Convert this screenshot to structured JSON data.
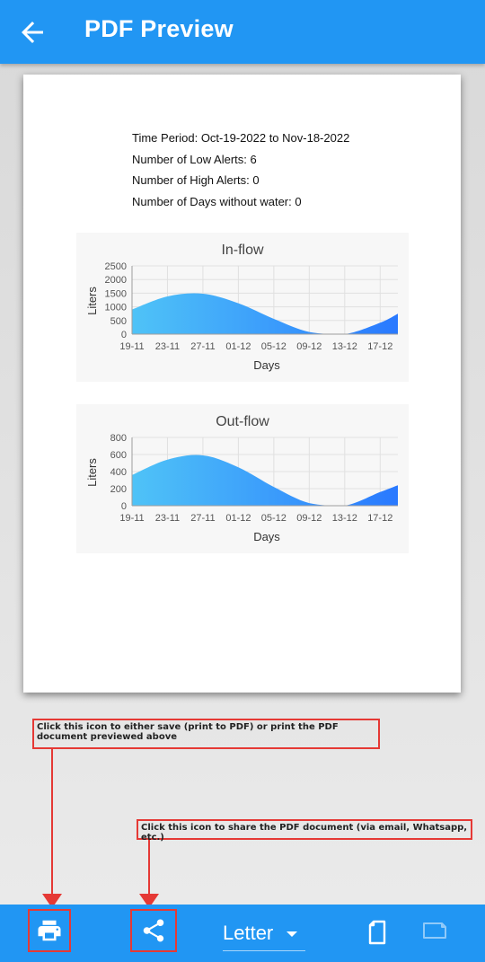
{
  "app_bar": {
    "title": "PDF Preview"
  },
  "icons": {
    "back": "arrow-back-icon",
    "print": "printer-icon",
    "share": "share-icon",
    "portrait": "portrait-page-icon",
    "landscape": "landscape-page-icon",
    "dropdown": "caret-down-icon"
  },
  "colors": {
    "accent": "#2196f3",
    "gradient_start": "#4fc3f7",
    "gradient_end": "#2979ff",
    "annotation": "#e53935"
  },
  "summary": {
    "time_period": "Time Period: Oct-19-2022 to Nov-18-2022",
    "low_alerts": "Number of Low Alerts: 6",
    "high_alerts": "Number of High Alerts: 0",
    "days_without_water": "Number of Days without water: 0"
  },
  "chart_data": [
    {
      "type": "area",
      "title": "In-flow",
      "xlabel": "Days",
      "ylabel": "Liters",
      "x_tick_labels": [
        "19-11",
        "23-11",
        "27-11",
        "01-12",
        "05-12",
        "09-12",
        "13-12",
        "17-12"
      ],
      "y_ticks": [
        0,
        500,
        1000,
        1500,
        2000,
        2500
      ],
      "ylim": [
        0,
        2500
      ],
      "grid": true,
      "series": [
        {
          "x": [
            0,
            4,
            8,
            12,
            16,
            20,
            24,
            28,
            30
          ],
          "values": [
            900,
            1380,
            1480,
            1130,
            560,
            80,
            0,
            420,
            750
          ]
        }
      ]
    },
    {
      "type": "area",
      "title": "Out-flow",
      "xlabel": "Days",
      "ylabel": "Liters",
      "x_tick_labels": [
        "19-11",
        "23-11",
        "27-11",
        "01-12",
        "05-12",
        "09-12",
        "13-12",
        "17-12"
      ],
      "y_ticks": [
        0,
        200,
        400,
        600,
        800
      ],
      "ylim": [
        0,
        800
      ],
      "grid": true,
      "series": [
        {
          "x": [
            0,
            4,
            8,
            12,
            16,
            20,
            24,
            28,
            30
          ],
          "values": [
            360,
            540,
            590,
            450,
            220,
            30,
            0,
            160,
            240
          ]
        }
      ]
    }
  ],
  "annotations": {
    "print_hint": "Click this icon to either save (print to PDF) or print the PDF document previewed above",
    "share_hint": "Click this icon to share the PDF document (via email, Whatsapp, etc.)"
  },
  "bottom_bar": {
    "page_size": "Letter"
  }
}
